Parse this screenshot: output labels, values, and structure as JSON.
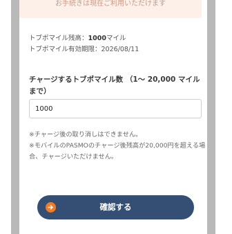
{
  "notice": {
    "text": "お手続きは現在ご利用いただけます"
  },
  "balance": {
    "label": "トブポマイル残高：",
    "value": "1000",
    "unit": "マイル"
  },
  "expiry": {
    "label": "トブポマイル有効期限：",
    "value": "2026/08/11"
  },
  "charge": {
    "label": "チャージするトブポマイル数 （1～ 20,000 マイルまで）",
    "input_value": "1000",
    "min": 1,
    "max": 20000
  },
  "notes": [
    "※チャージ後の取り消しはできません。",
    "※モバイルのPASMOのチャージ後残高が20,000円を超える場合、チャージいただけません。"
  ],
  "confirm": {
    "label": "確認する",
    "icon": "arrow-right-circle-icon",
    "color": "#344f73",
    "icon_color": "#ee7d2b"
  }
}
